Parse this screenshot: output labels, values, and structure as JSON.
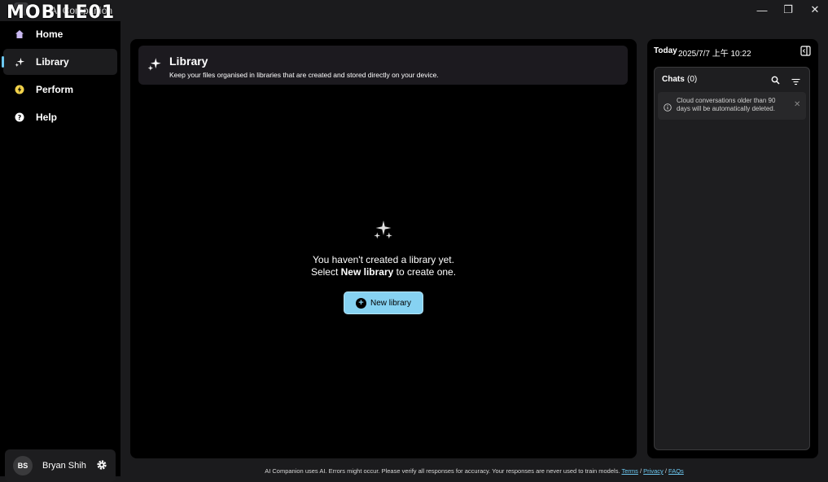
{
  "window": {
    "title": "AI Companion",
    "watermark": "MOBILE01",
    "controls": {
      "minimize": "—",
      "restore": "❐",
      "close": "✕"
    }
  },
  "sidebar": {
    "items": [
      {
        "label": "Home",
        "icon": "home-icon",
        "active": false
      },
      {
        "label": "Library",
        "icon": "sparkle-icon",
        "active": true
      },
      {
        "label": "Perform",
        "icon": "lightning-icon",
        "active": false
      },
      {
        "label": "Help",
        "icon": "help-icon",
        "active": false
      }
    ],
    "user": {
      "initials": "BS",
      "name": "Bryan Shih"
    }
  },
  "main": {
    "header": {
      "title": "Library",
      "subtitle": "Keep your files organised in libraries that are created and stored directly on your device."
    },
    "empty": {
      "line1": "You haven't created a library yet.",
      "line2_prefix": "Select ",
      "line2_bold": "New library",
      "line2_suffix": " to create one."
    },
    "new_library_button": "New library"
  },
  "right_panel": {
    "today_label": "Today",
    "date": "2025/7/7 上午 10:22",
    "chats_title": "Chats",
    "chats_count": "(0)",
    "notice": "Cloud conversations older than 90 days will be automatically deleted."
  },
  "footer": {
    "text": "AI Companion uses AI. Errors might occur. Please verify all responses for accuracy. Your responses are never used to train models.",
    "links": [
      "Terms",
      "Privacy",
      "FAQs"
    ],
    "separator": " / "
  },
  "colors": {
    "accent": "#86d2f2",
    "active_indicator": "#6cc7f0",
    "panel_bg": "#000000",
    "window_bg": "#1b1b1d"
  }
}
